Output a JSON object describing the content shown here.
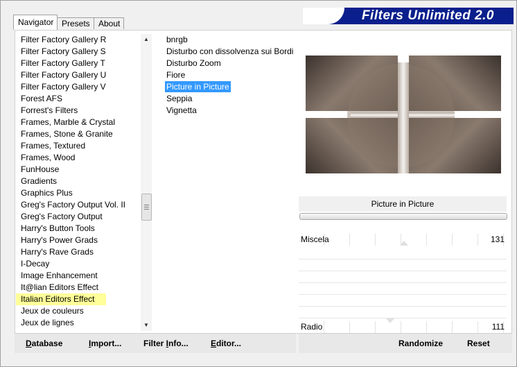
{
  "tabs": [
    {
      "label": "Navigator",
      "active": true
    },
    {
      "label": "Presets",
      "active": false
    },
    {
      "label": "About",
      "active": false
    }
  ],
  "title": "Filters Unlimited 2.0",
  "categories": [
    "Filter Factory Gallery R",
    "Filter Factory Gallery S",
    "Filter Factory Gallery T",
    "Filter Factory Gallery U",
    "Filter Factory Gallery V",
    "Forest AFS",
    "Forrest's Filters",
    "Frames, Marble & Crystal",
    "Frames, Stone & Granite",
    "Frames, Textured",
    "Frames, Wood",
    "FunHouse",
    "Gradients",
    "Graphics Plus",
    "Greg's Factory Output Vol. II",
    "Greg's Factory Output",
    "Harry's Button Tools",
    "Harry's Power Grads",
    "Harry's Rave Grads",
    "I-Decay",
    "Image Enhancement",
    "It@lian Editors Effect",
    "Italian Editors Effect",
    "Jeux de couleurs",
    "Jeux de lignes"
  ],
  "selected_category": "Italian Editors Effect",
  "filters": [
    "bnrgb",
    "Disturbo con dissolvenza sui Bordi",
    "Disturbo Zoom",
    "Fiore",
    "Picture in Picture",
    "Seppia",
    "Vignetta"
  ],
  "selected_filter": "Picture in Picture",
  "filter_title": "Picture in Picture",
  "parameters": [
    {
      "label": "Miscela",
      "value": "131"
    },
    {
      "label": "Radio",
      "value": "111"
    }
  ],
  "buttons": {
    "database": {
      "u": "D",
      "rest": "atabase"
    },
    "import": {
      "u": "I",
      "rest": "mport..."
    },
    "filter_info": {
      "pre": "Filter ",
      "u": "I",
      "rest": "nfo..."
    },
    "editor": {
      "u": "E",
      "rest": "ditor..."
    },
    "randomize": "Randomize",
    "reset": "Reset"
  },
  "colors": {
    "banner": "#0a1f8c",
    "selection": "#3399ff",
    "highlight": "#ffff99"
  }
}
